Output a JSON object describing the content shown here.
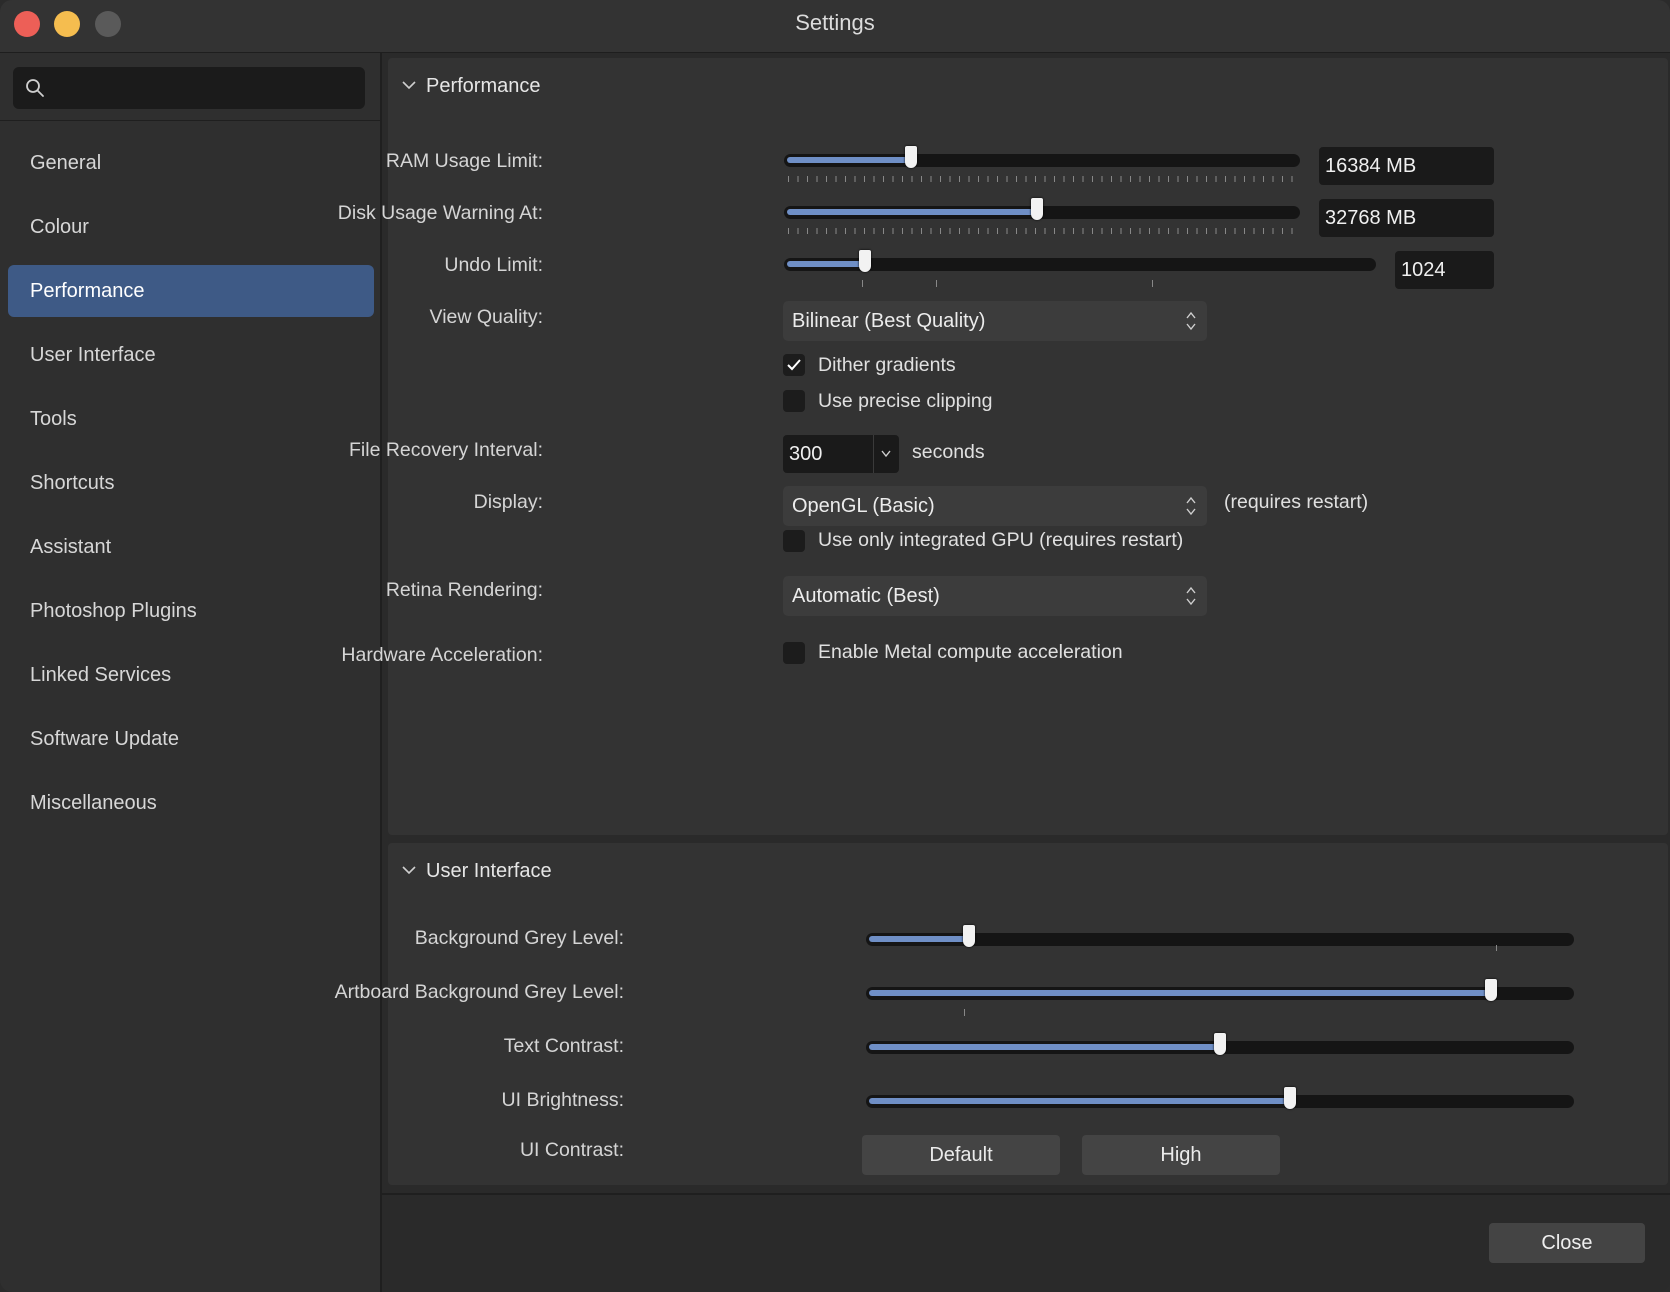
{
  "window": {
    "title": "Settings"
  },
  "search": {
    "placeholder": ""
  },
  "sidebar": {
    "items": [
      {
        "label": "General"
      },
      {
        "label": "Colour"
      },
      {
        "label": "Performance",
        "active": true
      },
      {
        "label": "User Interface"
      },
      {
        "label": "Tools"
      },
      {
        "label": "Shortcuts"
      },
      {
        "label": "Assistant"
      },
      {
        "label": "Photoshop Plugins"
      },
      {
        "label": "Linked Services"
      },
      {
        "label": "Software Update"
      },
      {
        "label": "Miscellaneous"
      }
    ]
  },
  "performance": {
    "title": "Performance",
    "ram": {
      "label": "RAM Usage Limit:",
      "value": "16384 MB",
      "level": 0.24
    },
    "disk": {
      "label": "Disk Usage Warning At:",
      "value": "32768 MB",
      "level": 0.49
    },
    "undo": {
      "label": "Undo Limit:",
      "value": "1024",
      "level": 0.13
    },
    "view_quality": {
      "label": "View Quality:",
      "value": "Bilinear (Best Quality)"
    },
    "dither": {
      "label": "Dither gradients",
      "checked": true
    },
    "precise_clipping": {
      "label": "Use precise clipping",
      "checked": false
    },
    "file_recovery": {
      "label": "File Recovery Interval:",
      "value": "300",
      "unit": "seconds"
    },
    "display": {
      "label": "Display:",
      "value": "OpenGL (Basic)",
      "note": "(requires restart)"
    },
    "integrated_gpu": {
      "label": "Use only integrated GPU (requires restart)",
      "checked": false
    },
    "retina": {
      "label": "Retina Rendering:",
      "value": "Automatic (Best)"
    },
    "hardware": {
      "label": "Hardware Acceleration:",
      "option": "Enable Metal compute acceleration",
      "checked": false
    }
  },
  "user_interface": {
    "title": "User Interface",
    "bg_grey": {
      "label": "Background Grey Level:",
      "level": 0.14
    },
    "artboard_grey": {
      "label": "Artboard Background Grey Level:",
      "level": 0.89
    },
    "text_contrast": {
      "label": "Text Contrast:",
      "level": 0.5
    },
    "ui_brightness": {
      "label": "UI Brightness:",
      "level": 0.6
    },
    "ui_contrast": {
      "label": "UI Contrast:",
      "options": [
        "Default",
        "High"
      ]
    }
  },
  "footer": {
    "close_label": "Close"
  },
  "colors": {
    "accent": "#3e5a86",
    "slider_fill": "#6f8fc6",
    "close": "#ed5f57",
    "minimize": "#f5bd4f"
  }
}
